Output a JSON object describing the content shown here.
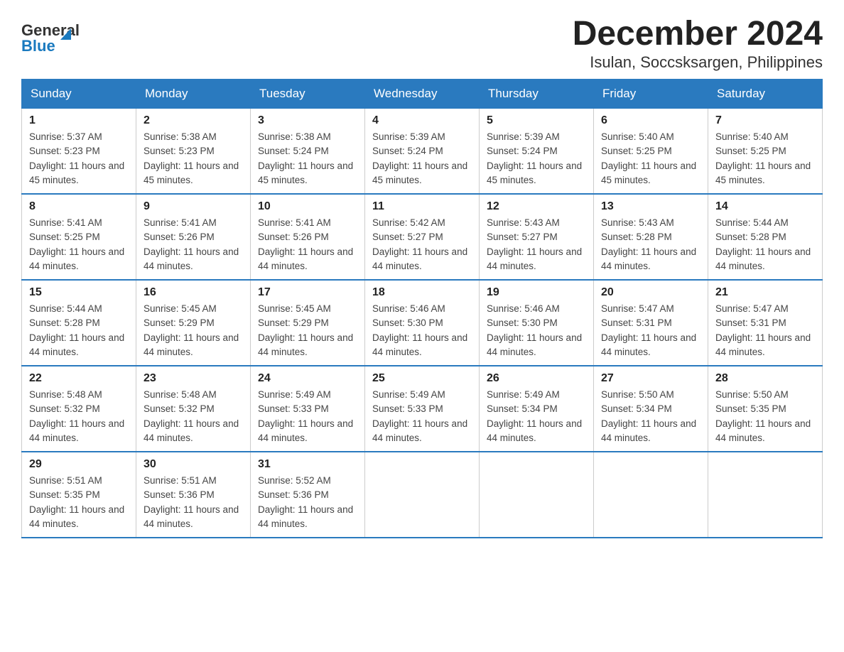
{
  "logo": {
    "general": "General",
    "blue": "Blue"
  },
  "title": "December 2024",
  "subtitle": "Isulan, Soccsksargen, Philippines",
  "weekdays": [
    "Sunday",
    "Monday",
    "Tuesday",
    "Wednesday",
    "Thursday",
    "Friday",
    "Saturday"
  ],
  "weeks": [
    [
      {
        "day": "1",
        "sunrise": "5:37 AM",
        "sunset": "5:23 PM",
        "daylight": "11 hours and 45 minutes."
      },
      {
        "day": "2",
        "sunrise": "5:38 AM",
        "sunset": "5:23 PM",
        "daylight": "11 hours and 45 minutes."
      },
      {
        "day": "3",
        "sunrise": "5:38 AM",
        "sunset": "5:24 PM",
        "daylight": "11 hours and 45 minutes."
      },
      {
        "day": "4",
        "sunrise": "5:39 AM",
        "sunset": "5:24 PM",
        "daylight": "11 hours and 45 minutes."
      },
      {
        "day": "5",
        "sunrise": "5:39 AM",
        "sunset": "5:24 PM",
        "daylight": "11 hours and 45 minutes."
      },
      {
        "day": "6",
        "sunrise": "5:40 AM",
        "sunset": "5:25 PM",
        "daylight": "11 hours and 45 minutes."
      },
      {
        "day": "7",
        "sunrise": "5:40 AM",
        "sunset": "5:25 PM",
        "daylight": "11 hours and 45 minutes."
      }
    ],
    [
      {
        "day": "8",
        "sunrise": "5:41 AM",
        "sunset": "5:25 PM",
        "daylight": "11 hours and 44 minutes."
      },
      {
        "day": "9",
        "sunrise": "5:41 AM",
        "sunset": "5:26 PM",
        "daylight": "11 hours and 44 minutes."
      },
      {
        "day": "10",
        "sunrise": "5:41 AM",
        "sunset": "5:26 PM",
        "daylight": "11 hours and 44 minutes."
      },
      {
        "day": "11",
        "sunrise": "5:42 AM",
        "sunset": "5:27 PM",
        "daylight": "11 hours and 44 minutes."
      },
      {
        "day": "12",
        "sunrise": "5:43 AM",
        "sunset": "5:27 PM",
        "daylight": "11 hours and 44 minutes."
      },
      {
        "day": "13",
        "sunrise": "5:43 AM",
        "sunset": "5:28 PM",
        "daylight": "11 hours and 44 minutes."
      },
      {
        "day": "14",
        "sunrise": "5:44 AM",
        "sunset": "5:28 PM",
        "daylight": "11 hours and 44 minutes."
      }
    ],
    [
      {
        "day": "15",
        "sunrise": "5:44 AM",
        "sunset": "5:28 PM",
        "daylight": "11 hours and 44 minutes."
      },
      {
        "day": "16",
        "sunrise": "5:45 AM",
        "sunset": "5:29 PM",
        "daylight": "11 hours and 44 minutes."
      },
      {
        "day": "17",
        "sunrise": "5:45 AM",
        "sunset": "5:29 PM",
        "daylight": "11 hours and 44 minutes."
      },
      {
        "day": "18",
        "sunrise": "5:46 AM",
        "sunset": "5:30 PM",
        "daylight": "11 hours and 44 minutes."
      },
      {
        "day": "19",
        "sunrise": "5:46 AM",
        "sunset": "5:30 PM",
        "daylight": "11 hours and 44 minutes."
      },
      {
        "day": "20",
        "sunrise": "5:47 AM",
        "sunset": "5:31 PM",
        "daylight": "11 hours and 44 minutes."
      },
      {
        "day": "21",
        "sunrise": "5:47 AM",
        "sunset": "5:31 PM",
        "daylight": "11 hours and 44 minutes."
      }
    ],
    [
      {
        "day": "22",
        "sunrise": "5:48 AM",
        "sunset": "5:32 PM",
        "daylight": "11 hours and 44 minutes."
      },
      {
        "day": "23",
        "sunrise": "5:48 AM",
        "sunset": "5:32 PM",
        "daylight": "11 hours and 44 minutes."
      },
      {
        "day": "24",
        "sunrise": "5:49 AM",
        "sunset": "5:33 PM",
        "daylight": "11 hours and 44 minutes."
      },
      {
        "day": "25",
        "sunrise": "5:49 AM",
        "sunset": "5:33 PM",
        "daylight": "11 hours and 44 minutes."
      },
      {
        "day": "26",
        "sunrise": "5:49 AM",
        "sunset": "5:34 PM",
        "daylight": "11 hours and 44 minutes."
      },
      {
        "day": "27",
        "sunrise": "5:50 AM",
        "sunset": "5:34 PM",
        "daylight": "11 hours and 44 minutes."
      },
      {
        "day": "28",
        "sunrise": "5:50 AM",
        "sunset": "5:35 PM",
        "daylight": "11 hours and 44 minutes."
      }
    ],
    [
      {
        "day": "29",
        "sunrise": "5:51 AM",
        "sunset": "5:35 PM",
        "daylight": "11 hours and 44 minutes."
      },
      {
        "day": "30",
        "sunrise": "5:51 AM",
        "sunset": "5:36 PM",
        "daylight": "11 hours and 44 minutes."
      },
      {
        "day": "31",
        "sunrise": "5:52 AM",
        "sunset": "5:36 PM",
        "daylight": "11 hours and 44 minutes."
      },
      null,
      null,
      null,
      null
    ]
  ],
  "labels": {
    "sunrise": "Sunrise:",
    "sunset": "Sunset:",
    "daylight": "Daylight:"
  }
}
